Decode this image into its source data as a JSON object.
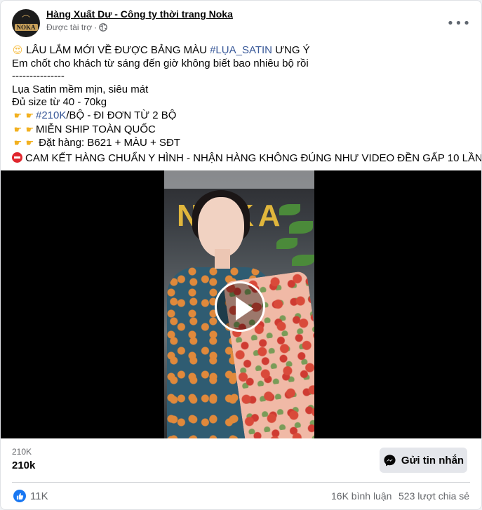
{
  "post": {
    "page_name": "Hàng Xuất Dư - Công ty thời trang Noka",
    "sponsored": "Được tài trợ",
    "avatar_text": "NOKA",
    "more_label": "•••",
    "caption": {
      "line1_pre": "LÂU LẮM MỚI VỀ ĐƯỢC BẢNG MÀU ",
      "line1_hashtag": "#LỤA_SATIN",
      "line1_post": " ƯNG Ý",
      "line2": "Em chốt cho khách từ sáng đến giờ không biết bao nhiêu bộ rồi",
      "line3": "---------------",
      "line4": "Lụa Satin mềm mịn, siêu mát",
      "line5": "Đủ size từ 40 - 70kg",
      "line6_hashtag": "#210K",
      "line6_post": "/BỘ - ĐI ĐƠN TỪ 2 BỘ",
      "line7": "MIỄN SHIP TOÀN QUỐC",
      "line8": " Đặt hàng: B621 + MÀU + SĐT",
      "line9": "CAM KẾT HÀNG CHUẨN Y HÌNH - NHẬN HÀNG KHÔNG ĐÚNG NHƯ VIDEO ĐỀN GẤP 10 LẦN"
    },
    "video": {
      "brand_letters": "NOKA"
    },
    "views_small": "210K",
    "views_big": "210k",
    "send_message_label": "Gửi tin nhắn",
    "reactions_count": "11K",
    "comments": "16K bình luận",
    "shares": "523 lượt chia sẻ"
  },
  "icons": {
    "emoji_love": "smiling-face-with-heart-eyes",
    "emoji_point": "backhand-index-pointing-right",
    "emoji_stop": "no-entry",
    "globe": "globe-icon",
    "messenger": "messenger-icon",
    "like": "like-icon"
  },
  "colors": {
    "hashtag": "#385898",
    "like_blue": "#1877f2",
    "secondary_text": "#65676b",
    "button_bg": "#e4e6eb"
  }
}
